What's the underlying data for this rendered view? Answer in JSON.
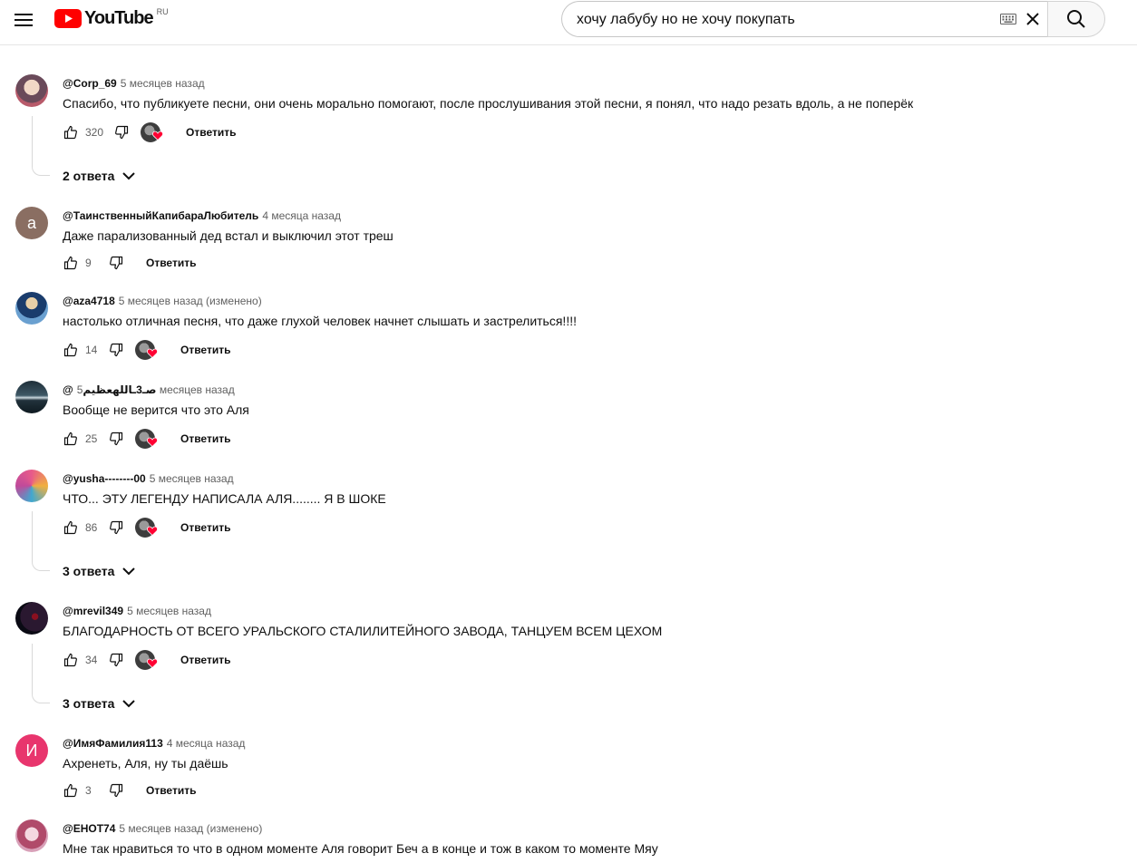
{
  "header": {
    "logo_text": "YouTube",
    "region": "RU",
    "search_value": "хочу лабубу но не хочу покупать",
    "icons": [
      "menu-icon",
      "youtube-logo-icon",
      "keyboard-icon",
      "close-icon",
      "search-icon"
    ]
  },
  "colors": {
    "brand_red": "#ff0000",
    "heart_red": "#ff0033"
  },
  "comments": [
    {
      "author": "@Corp_69",
      "time": "5 месяцев назад",
      "text": "Спасибо, что публикуете песни, они очень морально помогают, после прослушивания этой песни, я понял, что надо резать вдоль, а не поперёк",
      "likes": "320",
      "reply_label": "Ответить",
      "replies": "2 ответа"
    },
    {
      "author": "@ТаинственныйКапибараЛюбитель",
      "time": "4 месяца назад",
      "text": "Даже парализованный дед встал и выключил этот треш",
      "likes": "9",
      "reply_label": "Ответить",
      "avatar_letter": "а"
    },
    {
      "author": "@aza4718",
      "time": "5 месяцев назад (изменено)",
      "text": "настолько отличная песня, что даже глухой человек начнет слышать и застрелиться!!!!",
      "likes": "14",
      "reply_label": "Ответить"
    },
    {
      "author": "@صـ3ـاللهعظيم",
      "time": "5 месяцев назад",
      "text": "Вообще не верится что это Аля",
      "likes": "25",
      "reply_label": "Ответить"
    },
    {
      "author": "@yusha--------00",
      "time": "5 месяцев назад",
      "text": "ЧТО... ЭТУ ЛЕГЕНДУ НАПИСАЛА АЛЯ........ Я В ШОКЕ",
      "likes": "86",
      "reply_label": "Ответить",
      "replies": "3 ответа"
    },
    {
      "author": "@mrevil349",
      "time": "5 месяцев назад",
      "text": "БЛАГОДАРНОСТЬ ОТ ВСЕГО УРАЛЬСКОГО СТАЛИЛИТЕЙНОГО ЗАВОДА, ТАНЦУЕМ ВСЕМ ЦЕХОМ",
      "likes": "34",
      "reply_label": "Ответить",
      "replies": "3 ответа"
    },
    {
      "author": "@ИмяФамилия113",
      "time": "4 месяца назад",
      "text": "Ахренеть, Аля, ну ты даёшь",
      "likes": "3",
      "reply_label": "Ответить",
      "avatar_letter": "И"
    },
    {
      "author": "@EHOT74",
      "time": "5 месяцев назад (изменено)",
      "text": "Мне так нравиться то что в одном моменте Аля говорит Беч а в конце и тож в каком то моменте Мяу"
    }
  ]
}
